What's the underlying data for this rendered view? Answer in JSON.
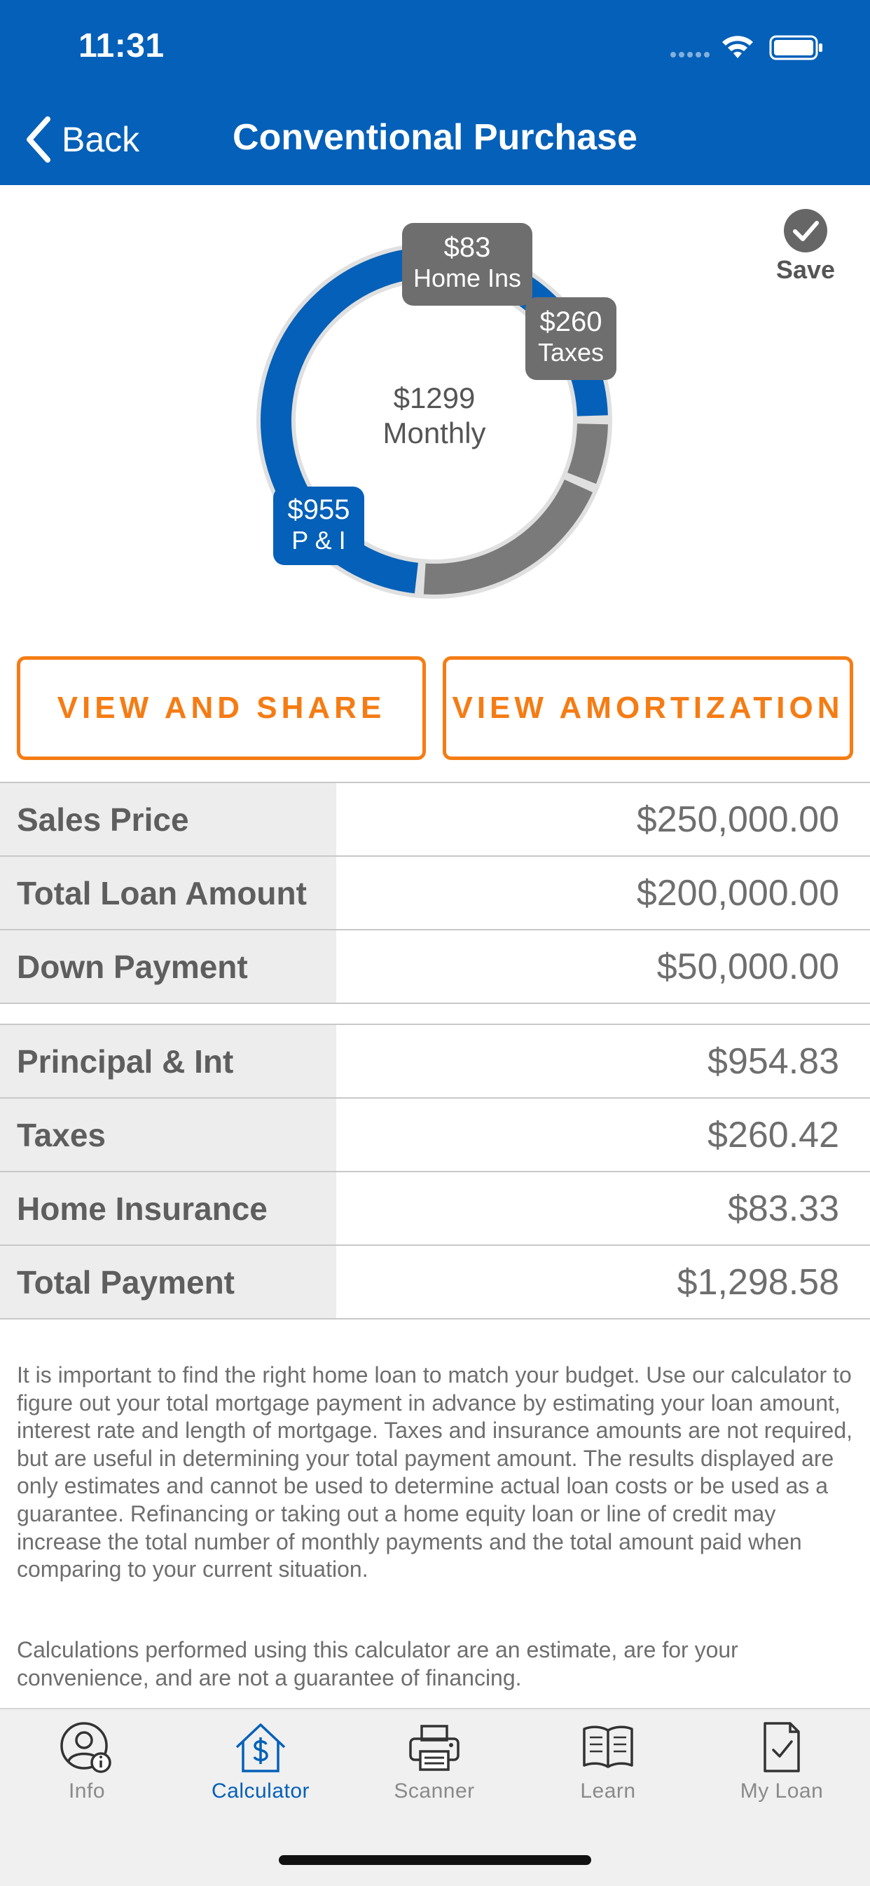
{
  "status_bar": {
    "time": "11:31"
  },
  "nav": {
    "back_label": "Back",
    "title": "Conventional Purchase"
  },
  "colors": {
    "brand_blue": "#0460B8",
    "accent_orange": "#F57C14",
    "segment_gray": "#7A7A7A"
  },
  "chart_data": {
    "type": "pie",
    "center_amount": "$1299",
    "center_label": "Monthly",
    "slices": [
      {
        "amount": "$955",
        "label": "P & I",
        "value": 954.83,
        "color": "#0460B8"
      },
      {
        "amount": "$260",
        "label": "Taxes",
        "value": 260.42,
        "color": "#7A7A7A"
      },
      {
        "amount": "$83",
        "label": "Home Ins",
        "value": 83.33,
        "color": "#7A7A7A"
      }
    ]
  },
  "save": {
    "label": "Save",
    "icon": "checkmark-circle-icon"
  },
  "buttons": {
    "view_share": "VIEW AND SHARE",
    "view_amortization": "VIEW AMORTIZATION"
  },
  "loan_table": [
    {
      "label": "Sales Price",
      "value": "$250,000.00"
    },
    {
      "label": "Total Loan Amount",
      "value": "$200,000.00"
    },
    {
      "label": "Down Payment",
      "value": "$50,000.00"
    }
  ],
  "payment_table": [
    {
      "label": "Principal & Int",
      "value": "$954.83"
    },
    {
      "label": "Taxes",
      "value": "$260.42"
    },
    {
      "label": "Home Insurance",
      "value": "$83.33"
    },
    {
      "label": "Total Payment",
      "value": "$1,298.58"
    }
  ],
  "disclaimer": {
    "paragraph1": "It is important to find the right home loan to match your budget. Use our calculator to figure out your total mortgage payment in advance by estimating your loan amount, interest rate and length of mortgage. Taxes and insurance amounts are not required, but are useful in determining your total payment amount.  The results displayed are only estimates and cannot be used to determine actual loan costs or be used as a guarantee. Refinancing or taking out a home equity loan or line of credit may increase the total number of monthly payments and the total amount paid when comparing to your current situation.",
    "paragraph2": "Calculations performed using this calculator are an estimate, are for your convenience, and are not a guarantee of financing."
  },
  "tabs": [
    {
      "label": "Info",
      "icon": "person-info-icon",
      "active": false
    },
    {
      "label": "Calculator",
      "icon": "house-dollar-icon",
      "active": true
    },
    {
      "label": "Scanner",
      "icon": "printer-icon",
      "active": false
    },
    {
      "label": "Learn",
      "icon": "open-book-icon",
      "active": false
    },
    {
      "label": "My Loan",
      "icon": "document-check-icon",
      "active": false
    }
  ]
}
